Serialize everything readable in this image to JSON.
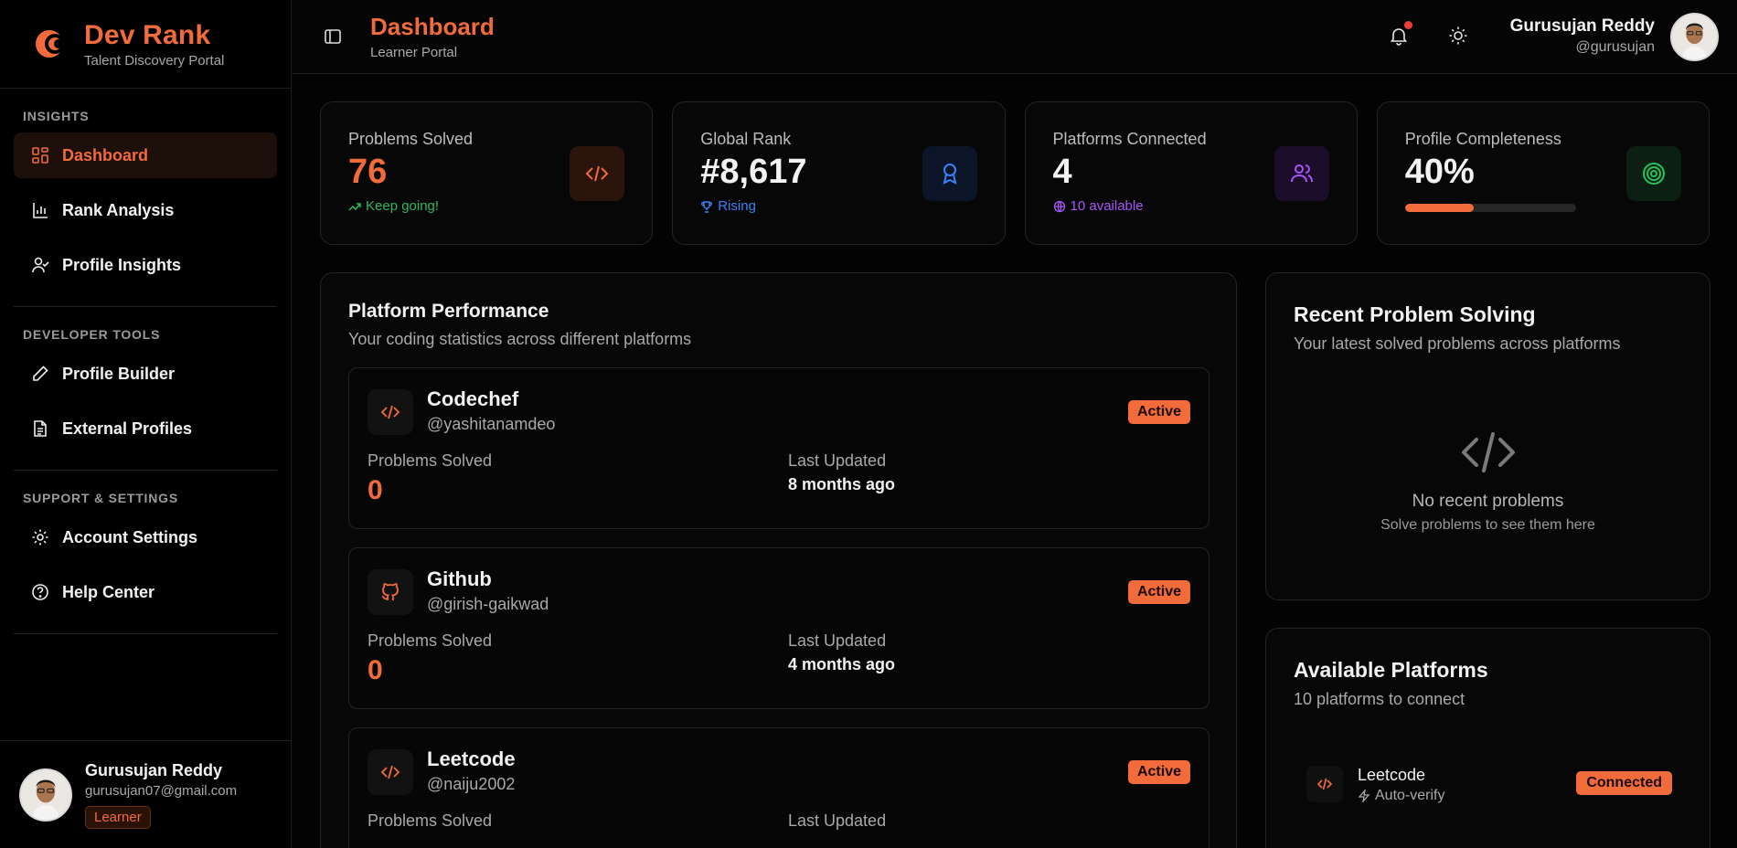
{
  "brand": {
    "title": "Dev Rank",
    "subtitle": "Talent Discovery Portal"
  },
  "sidebar": {
    "sections": [
      {
        "heading": "INSIGHTS",
        "items": [
          {
            "label": "Dashboard",
            "icon": "grid-icon",
            "active": true
          },
          {
            "label": "Rank Analysis",
            "icon": "bar-chart-icon"
          },
          {
            "label": "Profile Insights",
            "icon": "user-check-icon"
          }
        ]
      },
      {
        "heading": "DEVELOPER TOOLS",
        "items": [
          {
            "label": "Profile Builder",
            "icon": "pen-icon"
          },
          {
            "label": "External Profiles",
            "icon": "document-icon"
          }
        ]
      },
      {
        "heading": "SUPPORT & SETTINGS",
        "items": [
          {
            "label": "Account Settings",
            "icon": "gear-icon"
          },
          {
            "label": "Help Center",
            "icon": "help-circle-icon"
          }
        ]
      }
    ],
    "user": {
      "name": "Gurusujan Reddy",
      "email": "gurusujan07@gmail.com",
      "role": "Learner"
    }
  },
  "header": {
    "title": "Dashboard",
    "subtitle": "Learner Portal",
    "user_name": "Gurusujan Reddy",
    "user_handle": "@gurusujan"
  },
  "stats": [
    {
      "label": "Problems Solved",
      "value": "76",
      "note": "Keep going!",
      "note_color": "#2fb85c",
      "value_color": "#f26b3a",
      "icon": "code-icon",
      "icon_bg": "#2a140b",
      "icon_color": "#f26b3a"
    },
    {
      "label": "Global Rank",
      "value": "#8,617",
      "note": "Rising",
      "note_color": "#3b82f6",
      "value_color": "#f5f5f5",
      "icon": "award-icon",
      "icon_bg": "#0b1527",
      "icon_color": "#3b82f6"
    },
    {
      "label": "Platforms Connected",
      "value": "4",
      "note": "10 available",
      "note_color": "#a855f7",
      "value_color": "#f5f5f5",
      "icon": "users-icon",
      "icon_bg": "#1c0e2a",
      "icon_color": "#a855f7"
    },
    {
      "label": "Profile Completeness",
      "value": "40%",
      "progress": 40,
      "value_color": "#f5f5f5",
      "icon": "target-icon",
      "icon_bg": "#0b1f12",
      "icon_color": "#22c55e"
    }
  ],
  "performance": {
    "title": "Platform Performance",
    "subtitle": "Your coding statistics across different platforms",
    "solved_label": "Problems Solved",
    "updated_label": "Last Updated",
    "platforms": [
      {
        "name": "Codechef",
        "handle": "@yashitanamdeo",
        "status": "Active",
        "solved": "0",
        "updated": "8 months ago",
        "icon": "code-icon"
      },
      {
        "name": "Github",
        "handle": "@girish-gaikwad",
        "status": "Active",
        "solved": "0",
        "updated": "4 months ago",
        "icon": "github-icon"
      },
      {
        "name": "Leetcode",
        "handle": "@naiju2002",
        "status": "Active",
        "solved": "",
        "updated": "",
        "icon": "code-icon"
      }
    ]
  },
  "recent": {
    "title": "Recent Problem Solving",
    "subtitle": "Your latest solved problems across platforms",
    "empty_title": "No recent problems",
    "empty_sub": "Solve problems to see them here"
  },
  "available": {
    "title": "Available Platforms",
    "subtitle": "10 platforms to connect",
    "items": [
      {
        "name": "Leetcode",
        "meta": "Auto-verify",
        "status": "Connected",
        "icon": "code-icon"
      }
    ]
  },
  "colors": {
    "accent": "#f26b3a",
    "background": "#030303"
  }
}
